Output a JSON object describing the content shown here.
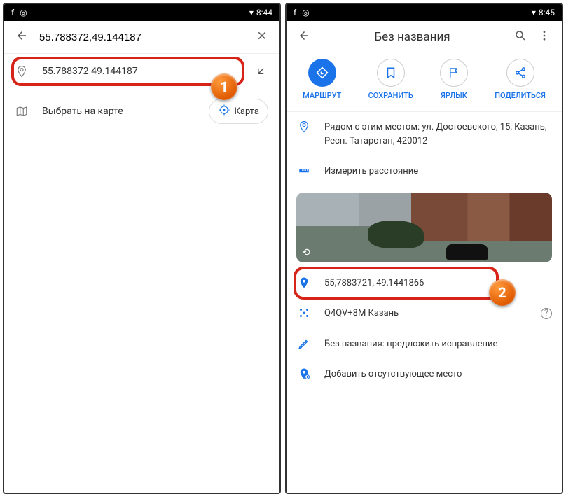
{
  "left": {
    "time": "8:44",
    "search_value": "55.788372,49.144187",
    "suggestion": "55.788372 49.144187",
    "choose_on_map": "Выбрать на карте",
    "map_button": "Карта"
  },
  "right": {
    "time": "8:45",
    "title": "Без названия",
    "actions": {
      "route": "МАРШРУТ",
      "save": "СОХРАНИТЬ",
      "label": "ЯРЛЫК",
      "share": "ПОДЕЛИТЬСЯ"
    },
    "nearby": "Рядом с этим местом: ул. Достоевского, 15, Казань, Респ. Татарстан, 420012",
    "measure": "Измерить расстояние",
    "coordinates": "55,7883721, 49,1441866",
    "plus_code": "Q4QV+8M Казань",
    "suggest_edit": "Без названия: предложить исправление",
    "add_missing": "Добавить отсутствующее место"
  },
  "badges": {
    "one": "1",
    "two": "2"
  }
}
